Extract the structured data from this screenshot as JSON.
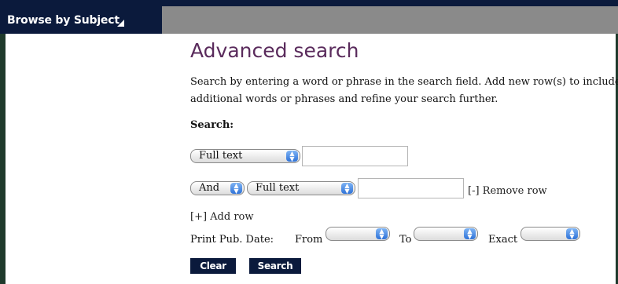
{
  "nav": {
    "browse_label": "Browse by Subject"
  },
  "page": {
    "title": "Advanced search",
    "description": "Search by entering a word or phrase in the search field. Add new row(s) to include additional words or phrases and refine your search further.",
    "search_label": "Search:"
  },
  "rows": {
    "row1": {
      "field_select": "Full text",
      "term_value": ""
    },
    "row2": {
      "operator_select": "And",
      "field_select": "Full text",
      "term_value": "",
      "remove_label": "[-] Remove row"
    }
  },
  "add_row_label": "[+] Add row",
  "date": {
    "label": "Print Pub. Date:",
    "from_label": "From",
    "to_label": "To",
    "exact_label": "Exact",
    "from_value": "",
    "to_value": "",
    "exact_value": ""
  },
  "buttons": {
    "clear": "Clear",
    "search": "Search"
  },
  "colors": {
    "nav_bg": "#0b1a3c",
    "title": "#5a2b5c",
    "toolbar_grey": "#8a8a8a"
  }
}
